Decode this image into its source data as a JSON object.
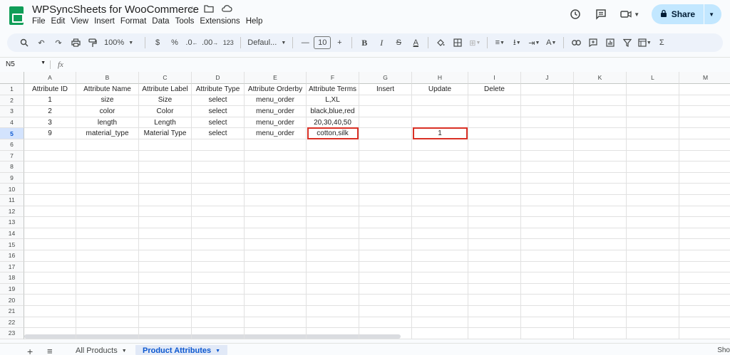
{
  "app": {
    "title": "WPSyncSheets for WooCommerce",
    "menus": [
      "File",
      "Edit",
      "View",
      "Insert",
      "Format",
      "Data",
      "Tools",
      "Extensions",
      "Help"
    ],
    "share_label": "Share"
  },
  "toolbar": {
    "zoom": "100%",
    "currency": "$",
    "percent": "%",
    "decrease_decimal": ".0",
    "increase_decimal": ".00",
    "number_format": "123",
    "font": "Defaul...",
    "font_size": "10",
    "bold": "B",
    "italic": "I",
    "text_color": "A",
    "function": "Σ"
  },
  "formula_bar": {
    "name_box": "N5",
    "fx": "fx"
  },
  "sheet": {
    "columns": [
      "A",
      "B",
      "C",
      "D",
      "E",
      "F",
      "G",
      "H",
      "I",
      "J",
      "K",
      "L",
      "M"
    ],
    "rows": [
      "1",
      "2",
      "3",
      "4",
      "5",
      "6",
      "7",
      "8",
      "9",
      "10",
      "11",
      "12",
      "13",
      "14",
      "15",
      "16",
      "17",
      "18",
      "19",
      "20",
      "21",
      "22",
      "23"
    ],
    "cells": [
      [
        "Attribute ID",
        "Attribute Name",
        "Attribute Label",
        "Attribute Type",
        "Attribute Orderby",
        "Attribute Terms",
        "Insert",
        "Update",
        "Delete"
      ],
      [
        "1",
        "size",
        "Size",
        "select",
        "menu_order",
        "L,XL",
        "",
        "",
        ""
      ],
      [
        "2",
        "color",
        "Color",
        "select",
        "menu_order",
        "black,blue,red",
        "",
        "",
        ""
      ],
      [
        "3",
        "length",
        "Length",
        "select",
        "menu_order",
        "20,30,40,50",
        "",
        "",
        ""
      ],
      [
        "9",
        "material_type",
        "Material Type",
        "select",
        "menu_order",
        "cotton,silk",
        "",
        "1",
        ""
      ]
    ],
    "active_row": "5",
    "highlighted_cells": [
      "F5",
      "H5"
    ]
  },
  "tabs": {
    "items": [
      "All Products",
      "Product Attributes"
    ],
    "active": "Product Attributes",
    "overflow_text": "Sho"
  }
}
